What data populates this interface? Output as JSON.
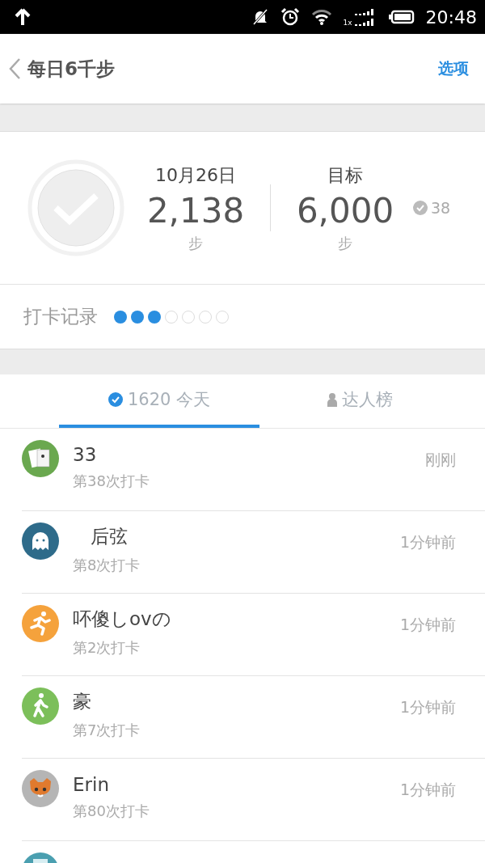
{
  "status_bar": {
    "time": "20:48",
    "network_label": "1x"
  },
  "header": {
    "title": "每日6千步",
    "action": "选项"
  },
  "summary": {
    "date": "10月26日",
    "steps": "2,138",
    "steps_unit": "步",
    "goal_label": "目标",
    "goal": "6,000",
    "goal_unit": "步",
    "checkins": "38",
    "done": false
  },
  "record": {
    "label": "打卡记录",
    "days": [
      {
        "filled": true
      },
      {
        "filled": true
      },
      {
        "filled": true
      },
      {
        "filled": false
      },
      {
        "filled": false
      },
      {
        "filled": false
      },
      {
        "filled": false
      }
    ]
  },
  "tabs": [
    {
      "kind": "check",
      "label": "1620 今天",
      "selected": true
    },
    {
      "kind": "person",
      "label": "达人榜",
      "selected": false
    }
  ],
  "feed": [
    {
      "kind": "cards",
      "color": "#6aa84f",
      "name": "33",
      "count": "第38次打卡",
      "time": "刚刚"
    },
    {
      "kind": "ghost",
      "color": "#2e6b8a",
      "name": "   后弦",
      "count": "第8次打卡",
      "time": "1分钟前"
    },
    {
      "kind": "runner",
      "color": "#f5a23c",
      "name": "吥傻しovの",
      "count": "第2次打卡",
      "time": "1分钟前"
    },
    {
      "kind": "walker",
      "color": "#7cbf5a",
      "name": "豪",
      "count": "第7次打卡",
      "time": "1分钟前"
    },
    {
      "kind": "cat",
      "color": "#b5b5b5",
      "name": "Erin",
      "count": "第80次打卡",
      "time": "1分钟前"
    },
    {
      "kind": "box",
      "color": "#4a9fb0"
    }
  ]
}
